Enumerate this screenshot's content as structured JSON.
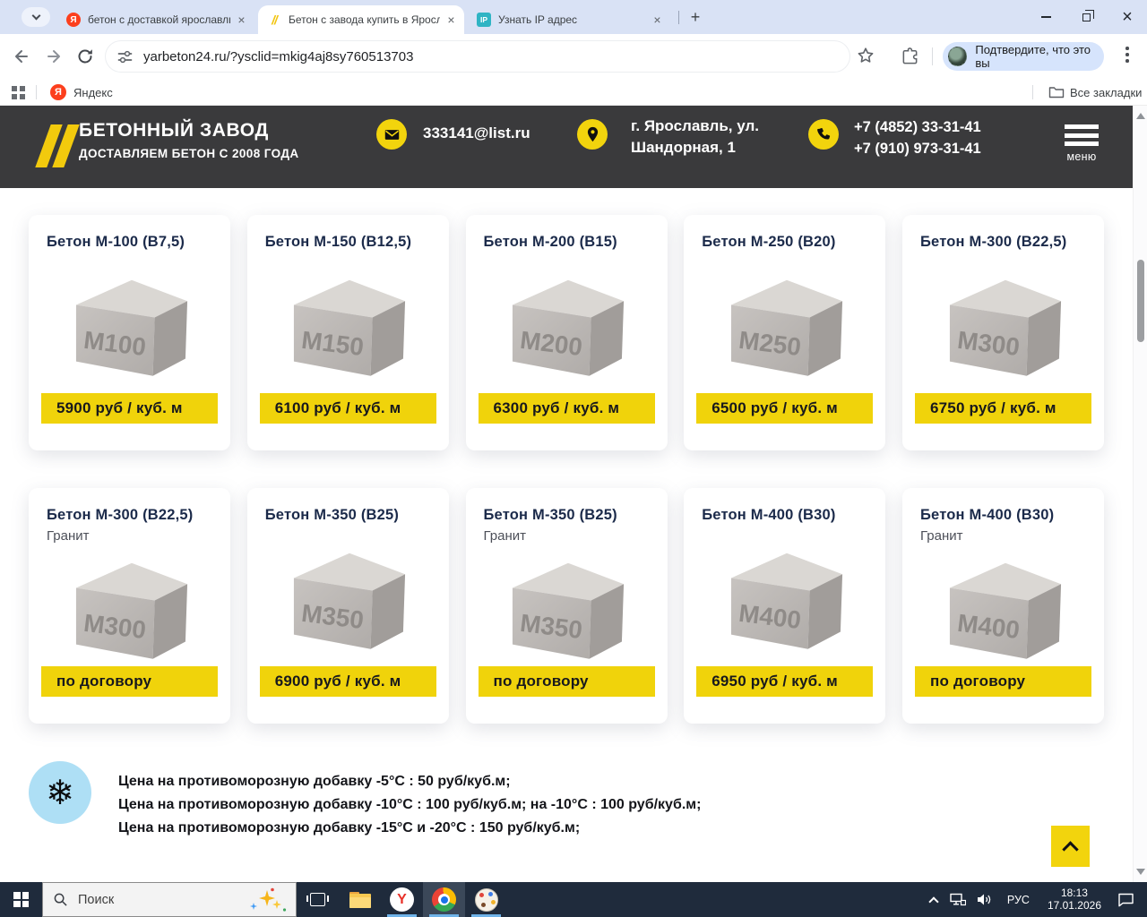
{
  "browser": {
    "tabs": [
      {
        "title": "бетон с доставкой ярославль"
      },
      {
        "title": "Бетон с завода купить в Яросл"
      },
      {
        "title": "Узнать IP адрес"
      }
    ],
    "new_tab": "+",
    "url": "yarbeton24.ru/?ysclid=mkig4aj8sy760513703",
    "identity_pill": "Подтвердите, что это вы",
    "bookmarks": {
      "yandex": "Яндекс",
      "all_bookmarks": "Все закладки"
    }
  },
  "site": {
    "brand": {
      "title": "БЕТОННЫЙ ЗАВОД",
      "subtitle": "ДОСТАВЛЯЕМ БЕТОН С 2008 ГОДА"
    },
    "contacts": {
      "email": "333141@list.ru",
      "address_line1": "г. Ярославль, ул.",
      "address_line2": "Шандорная, 1",
      "phone1": "+7 (4852) 33-31-41",
      "phone2": "+7 (910) 973-31-41",
      "menu_label": "меню"
    },
    "products": [
      {
        "title": "Бетон М-100 (В7,5)",
        "subtitle": "",
        "cube_label": "М100",
        "price": "5900 руб / куб. м"
      },
      {
        "title": "Бетон М-150 (В12,5)",
        "subtitle": "",
        "cube_label": "М150",
        "price": "6100 руб / куб. м"
      },
      {
        "title": "Бетон М-200 (В15)",
        "subtitle": "",
        "cube_label": "М200",
        "price": "6300 руб / куб. м"
      },
      {
        "title": "Бетон М-250 (В20)",
        "subtitle": "",
        "cube_label": "М250",
        "price": "6500 руб / куб. м"
      },
      {
        "title": "Бетон М-300 (В22,5)",
        "subtitle": "",
        "cube_label": "М300",
        "price": "6750 руб / куб. м"
      },
      {
        "title": "Бетон М-300 (В22,5)",
        "subtitle": "Гранит",
        "cube_label": "М300",
        "price": "по договору"
      },
      {
        "title": "Бетон М-350 (В25)",
        "subtitle": "",
        "cube_label": "М350",
        "price": "6900 руб / куб. м"
      },
      {
        "title": "Бетон М-350 (В25)",
        "subtitle": "Гранит",
        "cube_label": "М350",
        "price": "по договору"
      },
      {
        "title": "Бетон М-400 (В30)",
        "subtitle": "",
        "cube_label": "М400",
        "price": "6950 руб / куб. м"
      },
      {
        "title": "Бетон М-400 (В30)",
        "subtitle": "Гранит",
        "cube_label": "М400",
        "price": "по договору"
      }
    ],
    "notes": [
      "Цена на противоморозную добавку -5°С : 50 руб/куб.м;",
      "Цена на противоморозную добавку -10°С : 100 руб/куб.м; на -10°С : 100 руб/куб.м;",
      "Цена на противоморозную добавку -15°С и -20°С : 150 руб/куб.м;"
    ],
    "colors": {
      "accent_yellow": "#F0D30B",
      "header_bg": "#3A3A3C",
      "title_navy": "#1B2A4A"
    }
  },
  "taskbar": {
    "search_placeholder": "Поиск",
    "language": "РУС",
    "time": "18:13",
    "date": "17.01.2026"
  }
}
